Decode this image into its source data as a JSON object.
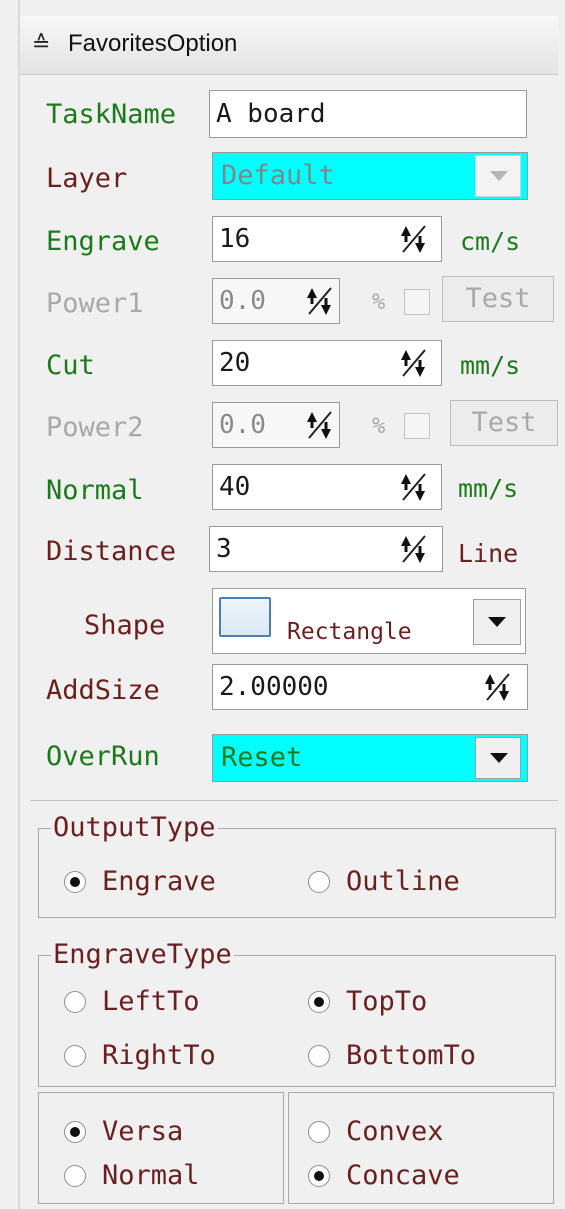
{
  "panel": {
    "title": "FavoritesOption",
    "collapse_icon": "double-chevron-down-icon"
  },
  "form": {
    "taskname": {
      "label": "TaskName",
      "value": "A board"
    },
    "layer": {
      "label": "Layer",
      "value": "Default",
      "highlight": "#00ffff"
    },
    "engrave": {
      "label": "Engrave",
      "value": "16",
      "unit": "cm/s"
    },
    "power1": {
      "label": "Power1",
      "value": "0.0",
      "unit": "%",
      "test": "Test"
    },
    "cut": {
      "label": "Cut",
      "value": "20",
      "unit": "mm/s"
    },
    "power2": {
      "label": "Power2",
      "value": "0.0",
      "unit": "%",
      "test": "Test"
    },
    "normal": {
      "label": "Normal",
      "value": "40",
      "unit": "mm/s"
    },
    "distance": {
      "label": "Distance",
      "value": "3",
      "unit": "Line"
    },
    "shape": {
      "label": "Shape",
      "value": "Rectangle"
    },
    "addsize": {
      "label": "AddSize",
      "value": "2.00000"
    },
    "overrun": {
      "label": "OverRun",
      "value": "Reset",
      "highlight": "#00ffff"
    }
  },
  "output_type": {
    "legend": "OutputType",
    "options": [
      {
        "label": "Engrave",
        "selected": true
      },
      {
        "label": "Outline",
        "selected": false
      }
    ]
  },
  "engrave_type": {
    "legend": "EngraveType",
    "options": [
      {
        "label": "LeftTo",
        "selected": false
      },
      {
        "label": "TopTo",
        "selected": true
      },
      {
        "label": "RightTo",
        "selected": false
      },
      {
        "label": "BottomTo",
        "selected": false
      }
    ]
  },
  "direction": {
    "options": [
      {
        "label": "Versa",
        "selected": true
      },
      {
        "label": "Normal",
        "selected": false
      }
    ]
  },
  "curvature": {
    "options": [
      {
        "label": "Convex",
        "selected": false
      },
      {
        "label": "Concave",
        "selected": true
      }
    ]
  },
  "colors": {
    "label_green": "#1c7a1c",
    "label_brown": "#6b2020",
    "disabled_gray": "#a8a8a8",
    "highlight_cyan": "#00ffff"
  }
}
